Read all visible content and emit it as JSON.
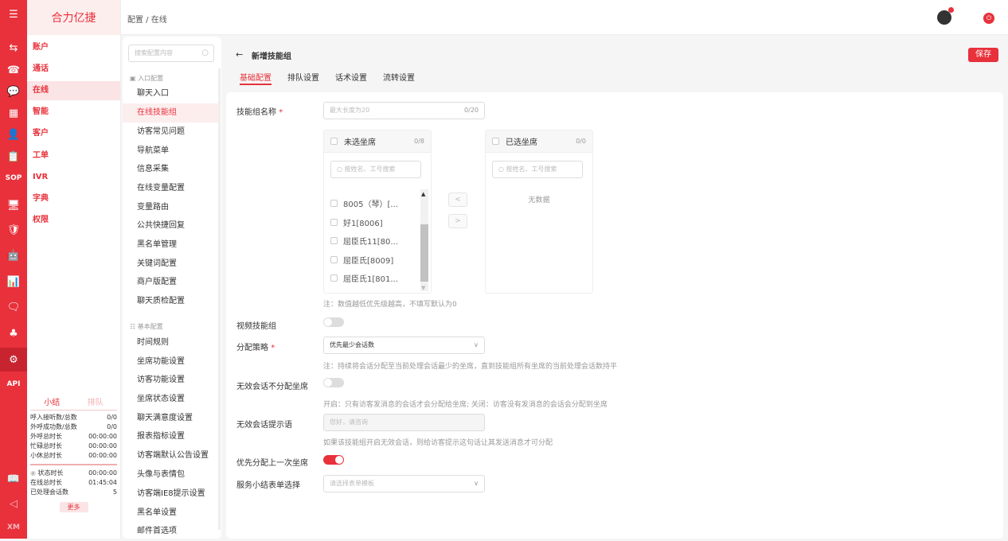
{
  "iconbar": {
    "items": [
      {
        "name": "menu-icon",
        "glyph": "☰"
      },
      {
        "name": "account-icon",
        "glyph": "⇆"
      },
      {
        "name": "phone-icon",
        "glyph": "☎"
      },
      {
        "name": "chat-icon",
        "glyph": "💬"
      },
      {
        "name": "smart-icon",
        "glyph": "▦"
      },
      {
        "name": "customer-icon",
        "glyph": "👤"
      },
      {
        "name": "ticket-icon",
        "glyph": "📋"
      },
      {
        "name": "sop-icon",
        "glyph": "SOP"
      },
      {
        "name": "monitor-icon",
        "glyph": "🖥"
      },
      {
        "name": "shield-icon",
        "glyph": "🛡"
      },
      {
        "name": "robot-icon",
        "glyph": "🤖"
      },
      {
        "name": "chart-icon",
        "glyph": "📊"
      },
      {
        "name": "message-icon",
        "glyph": "🗨"
      },
      {
        "name": "org-icon",
        "glyph": "♣"
      },
      {
        "name": "gear-icon",
        "glyph": "⚙"
      },
      {
        "name": "api-icon",
        "glyph": "API"
      },
      {
        "name": "book-icon",
        "glyph": "📖"
      },
      {
        "name": "speaker-icon",
        "glyph": "◁"
      },
      {
        "name": "xm-icon",
        "glyph": "XM"
      }
    ]
  },
  "nav": {
    "brand": "合力亿捷",
    "items": [
      "账户",
      "通话",
      "在线",
      "智能",
      "客户",
      "工单",
      "IVR",
      "字典",
      "权限"
    ]
  },
  "stats": {
    "tab_active": "小结",
    "tab_inactive": "排队",
    "rows": [
      {
        "label": "呼入接听数/总数",
        "value": "0/0"
      },
      {
        "label": "外呼成功数/总数",
        "value": "0/0"
      },
      {
        "label": "外呼总时长",
        "value": "00:00:00"
      },
      {
        "label": "忙碌总时长",
        "value": "00:00:00"
      },
      {
        "label": "小休总时长",
        "value": "00:00:00"
      },
      {
        "label": "状态时长",
        "value": "00:00:00"
      },
      {
        "label": "在线总时长",
        "value": "01:45:04"
      },
      {
        "label": "已处理会话数",
        "value": "5"
      }
    ],
    "more": "更多"
  },
  "topbar": {
    "breadcrumb": "配置 / 在线"
  },
  "cfgnav": {
    "search_placeholder": "搜索配置内容",
    "group1": "入口配置",
    "group1_items": [
      "聊天入口",
      "在线技能组",
      "访客常见问题",
      "导航菜单",
      "信息采集",
      "在线变量配置",
      "变量路由",
      "公共快捷回复",
      "黑名单管理",
      "关键词配置",
      "商户版配置",
      "聊天质检配置"
    ],
    "group2": "基本配置",
    "group2_items": [
      "时间规则",
      "坐席功能设置",
      "访客功能设置",
      "坐席状态设置",
      "聊天满意度设置",
      "报表指标设置",
      "访客端默认公告设置",
      "头像与表情包",
      "访客端IE8提示设置",
      "黑名单设置",
      "邮件首选项"
    ]
  },
  "main": {
    "back": "←",
    "title": "新增技能组",
    "save": "保存",
    "tabs": [
      "基础配置",
      "排队设置",
      "话术设置",
      "流转设置"
    ],
    "form": {
      "name_label": "技能组名称",
      "name_placeholder": "最大长度为20",
      "name_count": "0/20",
      "req_mark": "*",
      "left_box_title": "未选坐席",
      "left_box_count": "0/8",
      "right_box_title": "已选坐席",
      "right_box_count": "0/0",
      "box_search_placeholder": "按姓名、工号搜索",
      "left_list": [
        "8005（琴）[...",
        "好1[8006]",
        "屈臣氏11[80...",
        "屈臣氏[8009]",
        "屈臣氏1[801..."
      ],
      "empty": "无数据",
      "priority_note": "注：数值越低优先级越高，不填写默认为0",
      "video_label": "视频技能组",
      "strategy_label": "分配策略",
      "strategy_value": "优先最少会话数",
      "strategy_note": "注：持续将会话分配至当前处理会话最少的坐席，直到技能组所有坐席的当前处理会话数持平",
      "invalid_label": "无效会话不分配坐席",
      "invalid_note": "开启：只有访客发消息的会话才会分配给坐席; 关闭：访客没有发消息的会话会分配到坐席",
      "tip_label": "无效会话提示语",
      "tip_placeholder": "您好，请咨询",
      "tip_note": "如果该技能组开启无效会话，则给访客提示这句话让其发送消息才可分配",
      "last_label": "优先分配上一次坐席",
      "form_label": "服务小结表单选择",
      "form_placeholder": "请选择表单模板"
    }
  }
}
